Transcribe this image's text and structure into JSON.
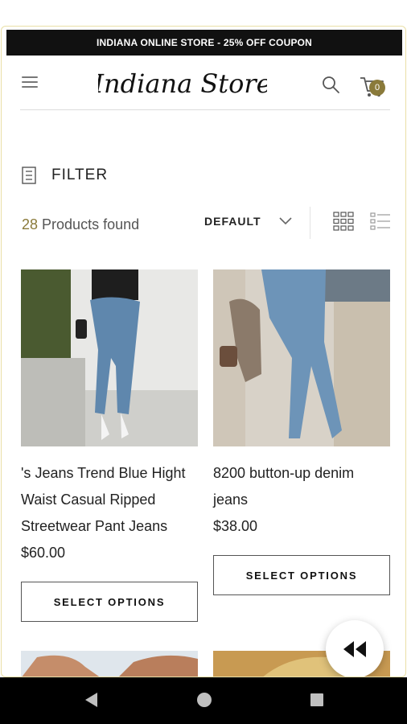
{
  "promo": {
    "text": "INDIANA ONLINE STORE - 25% OFF COUPON"
  },
  "header": {
    "logo_text": "Indiana Store",
    "cart_count": "0"
  },
  "toolbar": {
    "filter_label": "FILTER",
    "found_count": "28",
    "found_text": " Products found",
    "sort_label": "DEFAULT"
  },
  "products": [
    {
      "name_lines": [
        "'s Jeans Trend Blue Hight",
        "Waist Casual Ripped",
        "Streetwear Pant Jeans"
      ],
      "price": "$60.00",
      "button": "SELECT OPTIONS"
    },
    {
      "name_lines": [
        "8200 button-up denim",
        "jeans"
      ],
      "price": "$38.00",
      "button": "SELECT OPTIONS"
    }
  ],
  "colors": {
    "accent": "#8a7a3a",
    "promo_bg": "#111111",
    "nav_bg": "#000000"
  },
  "icons": [
    "menu-icon",
    "search-icon",
    "cart-icon",
    "filter-icon",
    "chevron-down-icon",
    "grid-view-icon",
    "list-view-icon",
    "rewind-icon",
    "back-icon",
    "home-icon",
    "recents-icon"
  ]
}
